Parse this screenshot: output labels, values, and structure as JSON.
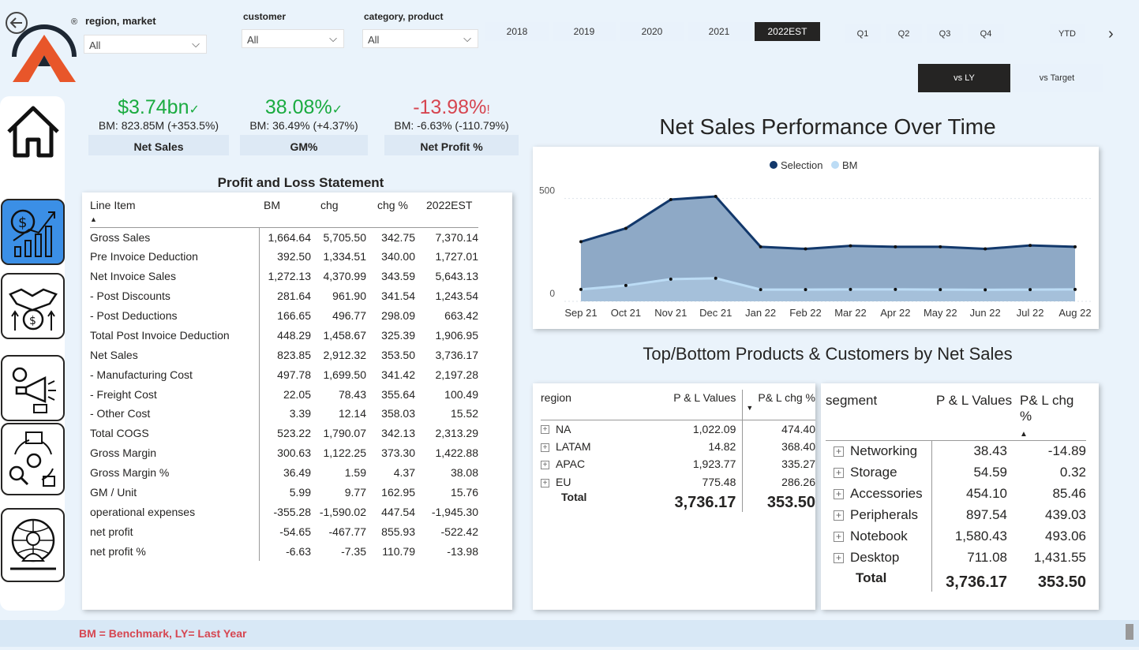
{
  "filters": {
    "region_market": {
      "label": "region, market",
      "value": "All"
    },
    "customer": {
      "label": "customer",
      "value": "All"
    },
    "category_product": {
      "label": "category, product",
      "value": "All"
    }
  },
  "years": [
    "2018",
    "2019",
    "2020",
    "2021",
    "2022EST"
  ],
  "selected_year": "2022EST",
  "quarters": [
    "Q1",
    "Q2",
    "Q3",
    "Q4"
  ],
  "ytd": "YTD",
  "compare": {
    "vs_ly": "vs LY",
    "vs_target": "vs Target",
    "selected": "vs LY"
  },
  "kpis": [
    {
      "value": "$3.74bn",
      "mark": "✓",
      "sub": "BM: 823.85M (+353.5%)",
      "name": "Net Sales",
      "color": "#1aab40"
    },
    {
      "value": "38.08%",
      "mark": "✓",
      "sub": "BM: 36.49% (+4.37%)",
      "name": "GM%",
      "color": "#1aab40"
    },
    {
      "value": "-13.98%",
      "mark": "!",
      "sub": "BM: -6.63% (-110.79%)",
      "name": "Net Profit %",
      "color": "#d64550"
    }
  ],
  "pl": {
    "title": "Profit and Loss Statement",
    "columns": [
      "Line Item",
      "BM",
      "chg",
      "chg %",
      "2022EST"
    ],
    "rows": [
      [
        "Gross Sales",
        "1,664.64",
        "5,705.50",
        "342.75",
        "7,370.14"
      ],
      [
        "Pre Invoice Deduction",
        "392.50",
        "1,334.51",
        "340.00",
        "1,727.01"
      ],
      [
        "Net Invoice Sales",
        "1,272.13",
        "4,370.99",
        "343.59",
        "5,643.13"
      ],
      [
        "- Post Discounts",
        "281.64",
        "961.90",
        "341.54",
        "1,243.54"
      ],
      [
        "- Post Deductions",
        "166.65",
        "496.77",
        "298.09",
        "663.42"
      ],
      [
        "Total Post Invoice Deduction",
        "448.29",
        "1,458.67",
        "325.39",
        "1,906.95"
      ],
      [
        "Net Sales",
        "823.85",
        "2,912.32",
        "353.50",
        "3,736.17"
      ],
      [
        "- Manufacturing Cost",
        "497.78",
        "1,699.50",
        "341.42",
        "2,197.28"
      ],
      [
        "- Freight Cost",
        "22.05",
        "78.43",
        "355.64",
        "100.49"
      ],
      [
        "- Other Cost",
        "3.39",
        "12.14",
        "358.03",
        "15.52"
      ],
      [
        "Total COGS",
        "523.22",
        "1,790.07",
        "342.13",
        "2,313.29"
      ],
      [
        "Gross Margin",
        "300.63",
        "1,122.25",
        "373.30",
        "1,422.88"
      ],
      [
        "Gross Margin %",
        "36.49",
        "1.59",
        "4.37",
        "38.08"
      ],
      [
        "GM / Unit",
        "5.99",
        "9.77",
        "162.95",
        "15.76"
      ],
      [
        "operational expenses",
        "-355.28",
        "-1,590.02",
        "447.54",
        "-1,945.30"
      ],
      [
        "net profit",
        "-54.65",
        "-467.77",
        "855.93",
        "-522.42"
      ],
      [
        "net profit %",
        "-6.63",
        "-7.35",
        "110.79",
        "-13.98"
      ]
    ]
  },
  "chart_title": "Net Sales Performance Over Time",
  "chart_data": {
    "type": "area",
    "x": [
      "Sep 21",
      "Oct 21",
      "Nov 21",
      "Dec 21",
      "Jan 22",
      "Feb 22",
      "Mar 22",
      "Apr 22",
      "May 22",
      "Jun 22",
      "Jul 22",
      "Aug 22"
    ],
    "series": [
      {
        "name": "Selection",
        "color": "#12386b",
        "values": [
          290,
          355,
          495,
          510,
          265,
          255,
          270,
          265,
          265,
          255,
          272,
          265
        ]
      },
      {
        "name": "BM",
        "color": "#bcdcf5",
        "values": [
          58,
          77,
          108,
          112,
          57,
          57,
          58,
          58,
          57,
          56,
          57,
          58
        ]
      }
    ],
    "yticks": [
      0,
      500
    ],
    "ylim": [
      0,
      560
    ],
    "legend": "top-center",
    "grid": true
  },
  "top_bottom_title": "Top/Bottom Products & Customers by Net Sales",
  "region_table": {
    "columns": [
      "region",
      "P & L Values",
      "P& L chg %"
    ],
    "rows": [
      [
        "NA",
        "1,022.09",
        "474.40"
      ],
      [
        "LATAM",
        "14.82",
        "368.40"
      ],
      [
        "APAC",
        "1,923.77",
        "335.27"
      ],
      [
        "EU",
        "775.48",
        "286.26"
      ]
    ],
    "total": [
      "Total",
      "3,736.17",
      "353.50"
    ]
  },
  "segment_table": {
    "columns": [
      "segment",
      "P & L Values",
      "P& L chg %"
    ],
    "rows": [
      [
        "Networking",
        "38.43",
        "-14.89"
      ],
      [
        "Storage",
        "54.59",
        "0.32"
      ],
      [
        "Accessories",
        "454.10",
        "85.46"
      ],
      [
        "Peripherals",
        "897.54",
        "439.03"
      ],
      [
        "Notebook",
        "1,580.43",
        "493.06"
      ],
      [
        "Desktop",
        "711.08",
        "1,431.55"
      ]
    ],
    "total": [
      "Total",
      "3,736.17",
      "353.50"
    ]
  },
  "footer_note": "BM = Benchmark, LY= Last Year",
  "logo_mark": "®"
}
